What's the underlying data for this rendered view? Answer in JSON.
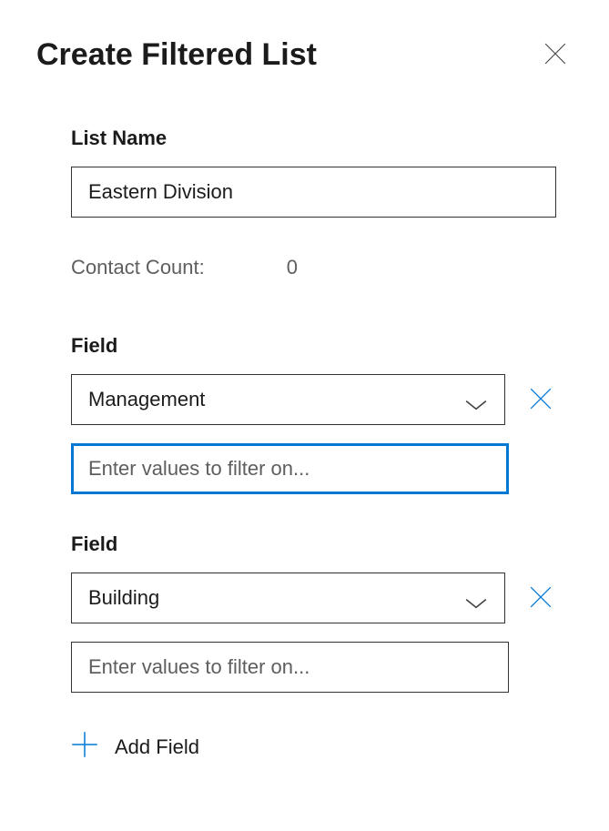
{
  "dialog": {
    "title": "Create Filtered List"
  },
  "listName": {
    "label": "List Name",
    "value": "Eastern Division"
  },
  "contactCount": {
    "label": "Contact Count:",
    "value": "0"
  },
  "filters": [
    {
      "fieldLabel": "Field",
      "selectedValue": "Management",
      "placeholder": "Enter values to filter on...",
      "focused": true
    },
    {
      "fieldLabel": "Field",
      "selectedValue": "Building",
      "placeholder": "Enter values to filter on...",
      "focused": false
    }
  ],
  "addField": {
    "label": "Add Field"
  }
}
